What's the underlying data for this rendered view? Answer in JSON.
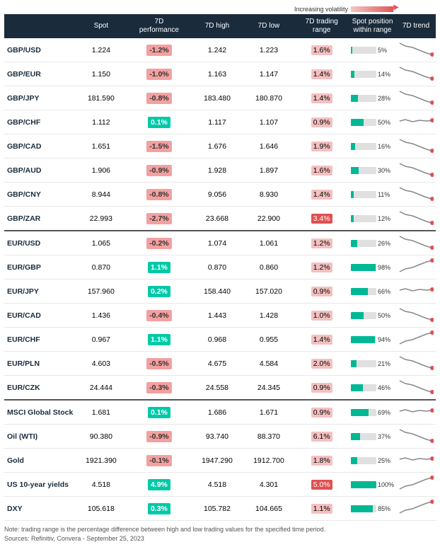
{
  "header": {
    "volatility_label": "Increasing volatility",
    "columns": [
      "",
      "Spot",
      "7D performance",
      "7D high",
      "7D low",
      "7D trading range",
      "Spot position within range",
      "7D trend"
    ]
  },
  "sections": [
    {
      "id": "gbp",
      "rows": [
        {
          "pair": "GBP/USD",
          "spot": "1.224",
          "perf": "-1.2%",
          "perf_type": "negative",
          "high": "1.242",
          "low": "1.223",
          "range": "1.6%",
          "range_type": "normal",
          "spot_pct": 5,
          "trend": "down"
        },
        {
          "pair": "GBP/EUR",
          "spot": "1.150",
          "perf": "-1.0%",
          "perf_type": "negative",
          "high": "1.163",
          "low": "1.147",
          "range": "1.4%",
          "range_type": "normal",
          "spot_pct": 14,
          "trend": "down"
        },
        {
          "pair": "GBP/JPY",
          "spot": "181.590",
          "perf": "-0.8%",
          "perf_type": "negative",
          "high": "183.480",
          "low": "180.870",
          "range": "1.4%",
          "range_type": "normal",
          "spot_pct": 28,
          "trend": "down"
        },
        {
          "pair": "GBP/CHF",
          "spot": "1.112",
          "perf": "0.1%",
          "perf_type": "positive",
          "high": "1.117",
          "low": "1.107",
          "range": "0.9%",
          "range_type": "normal",
          "spot_pct": 50,
          "trend": "flat"
        },
        {
          "pair": "GBP/CAD",
          "spot": "1.651",
          "perf": "-1.5%",
          "perf_type": "negative",
          "high": "1.676",
          "low": "1.646",
          "range": "1.9%",
          "range_type": "normal",
          "spot_pct": 16,
          "trend": "down"
        },
        {
          "pair": "GBP/AUD",
          "spot": "1.906",
          "perf": "-0.9%",
          "perf_type": "negative",
          "high": "1.928",
          "low": "1.897",
          "range": "1.6%",
          "range_type": "normal",
          "spot_pct": 30,
          "trend": "down"
        },
        {
          "pair": "GBP/CNY",
          "spot": "8.944",
          "perf": "-0.8%",
          "perf_type": "negative",
          "high": "9.056",
          "low": "8.930",
          "range": "1.4%",
          "range_type": "normal",
          "spot_pct": 11,
          "trend": "down"
        },
        {
          "pair": "GBP/ZAR",
          "spot": "22.993",
          "perf": "-2.7%",
          "perf_type": "high-negative",
          "high": "23.668",
          "low": "22.900",
          "range": "3.4%",
          "range_type": "high",
          "spot_pct": 12,
          "trend": "down"
        }
      ]
    },
    {
      "id": "eur",
      "rows": [
        {
          "pair": "EUR/USD",
          "spot": "1.065",
          "perf": "-0.2%",
          "perf_type": "negative",
          "high": "1.074",
          "low": "1.061",
          "range": "1.2%",
          "range_type": "normal",
          "spot_pct": 26,
          "trend": "down"
        },
        {
          "pair": "EUR/GBP",
          "spot": "0.870",
          "perf": "1.1%",
          "perf_type": "positive",
          "high": "0.870",
          "low": "0.860",
          "range": "1.2%",
          "range_type": "normal",
          "spot_pct": 98,
          "trend": "up"
        },
        {
          "pair": "EUR/JPY",
          "spot": "157.960",
          "perf": "0.2%",
          "perf_type": "positive",
          "high": "158.440",
          "low": "157.020",
          "range": "0.9%",
          "range_type": "normal",
          "spot_pct": 66,
          "trend": "flat"
        },
        {
          "pair": "EUR/CAD",
          "spot": "1.436",
          "perf": "-0.4%",
          "perf_type": "negative",
          "high": "1.443",
          "low": "1.428",
          "range": "1.0%",
          "range_type": "normal",
          "spot_pct": 50,
          "trend": "down"
        },
        {
          "pair": "EUR/CHF",
          "spot": "0.967",
          "perf": "1.1%",
          "perf_type": "positive",
          "high": "0.968",
          "low": "0.955",
          "range": "1.4%",
          "range_type": "normal",
          "spot_pct": 94,
          "trend": "up"
        },
        {
          "pair": "EUR/PLN",
          "spot": "4.603",
          "perf": "-0.5%",
          "perf_type": "negative",
          "high": "4.675",
          "low": "4.584",
          "range": "2.0%",
          "range_type": "normal",
          "spot_pct": 21,
          "trend": "down"
        },
        {
          "pair": "EUR/CZK",
          "spot": "24.444",
          "perf": "-0.3%",
          "perf_type": "negative",
          "high": "24.558",
          "low": "24.345",
          "range": "0.9%",
          "range_type": "normal",
          "spot_pct": 46,
          "trend": "down"
        }
      ]
    },
    {
      "id": "other",
      "rows": [
        {
          "pair": "MSCI Global Stock",
          "spot": "1.681",
          "perf": "0.1%",
          "perf_type": "positive",
          "high": "1.686",
          "low": "1.671",
          "range": "0.9%",
          "range_type": "normal",
          "spot_pct": 69,
          "trend": "flat"
        },
        {
          "pair": "Oil (WTI)",
          "spot": "90.380",
          "perf": "-0.9%",
          "perf_type": "negative",
          "high": "93.740",
          "low": "88.370",
          "range": "6.1%",
          "range_type": "normal",
          "spot_pct": 37,
          "trend": "down"
        },
        {
          "pair": "Gold",
          "spot": "1921.390",
          "perf": "-0.1%",
          "perf_type": "negative",
          "high": "1947.290",
          "low": "1912.700",
          "range": "1.8%",
          "range_type": "normal",
          "spot_pct": 25,
          "trend": "flat"
        },
        {
          "pair": "US 10-year yields",
          "spot": "4.518",
          "perf": "4.9%",
          "perf_type": "high-positive",
          "high": "4.518",
          "low": "4.301",
          "range": "5.0%",
          "range_type": "high",
          "spot_pct": 100,
          "trend": "up"
        },
        {
          "pair": "DXY",
          "spot": "105.618",
          "perf": "0.3%",
          "perf_type": "positive",
          "high": "105.782",
          "low": "104.665",
          "range": "1.1%",
          "range_type": "normal",
          "spot_pct": 85,
          "trend": "up"
        }
      ]
    }
  ],
  "note": "Note: trading range is the percentage difference between high and low trading values for the specified time period.",
  "sources": "Sources: Refinitiv, Convera - September 25, 2023"
}
